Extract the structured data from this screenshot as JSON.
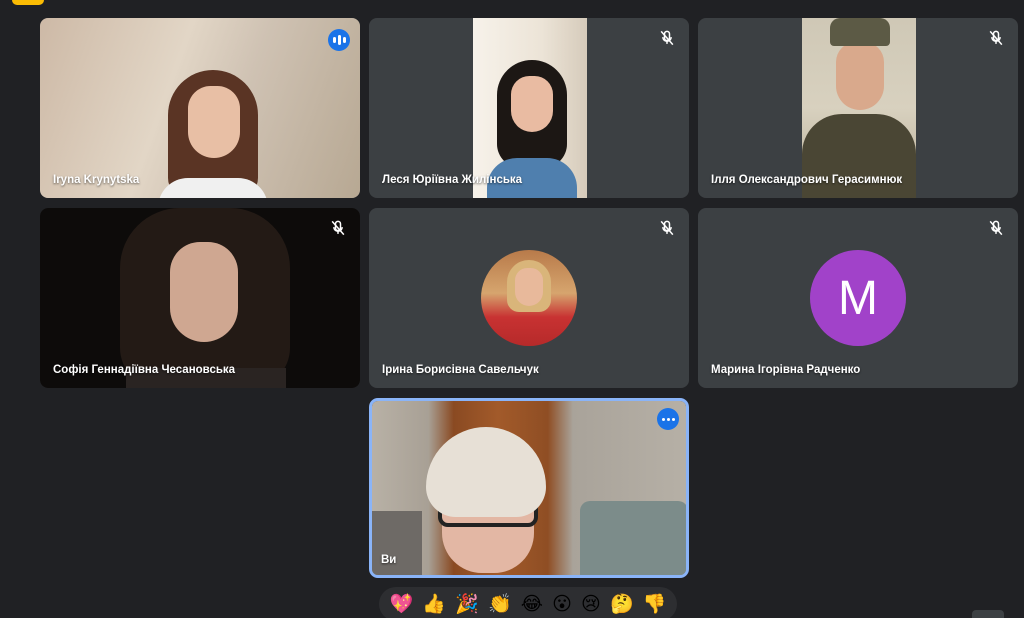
{
  "participants": [
    {
      "name": "Iryna Krynytska",
      "status": "speaking-icon"
    },
    {
      "name": "Леся Юріївна Жилінська",
      "status": "mic-off-icon"
    },
    {
      "name": "Ілля Олександрович Герасимнюк",
      "status": "mic-off-icon"
    },
    {
      "name": "Софія Геннадіївна Чесановська",
      "status": "mic-off-icon"
    },
    {
      "name": "Ірина Борисівна Савельчук",
      "status": "mic-off-icon"
    },
    {
      "name": "Марина Ігорівна Радченко",
      "status": "mic-off-icon",
      "avatar_letter": "M",
      "avatar_color": "#a142c9"
    },
    {
      "name": "Ви",
      "status": "more-options-icon",
      "self": true
    }
  ],
  "reactions": [
    "💖",
    "👍",
    "🎉",
    "👏",
    "😂",
    "😮",
    "😢",
    "🤔",
    "👎"
  ],
  "colors": {
    "background": "#202124",
    "tile": "#3c4043",
    "accent": "#8ab4f8",
    "speaking": "#1a73e8"
  }
}
